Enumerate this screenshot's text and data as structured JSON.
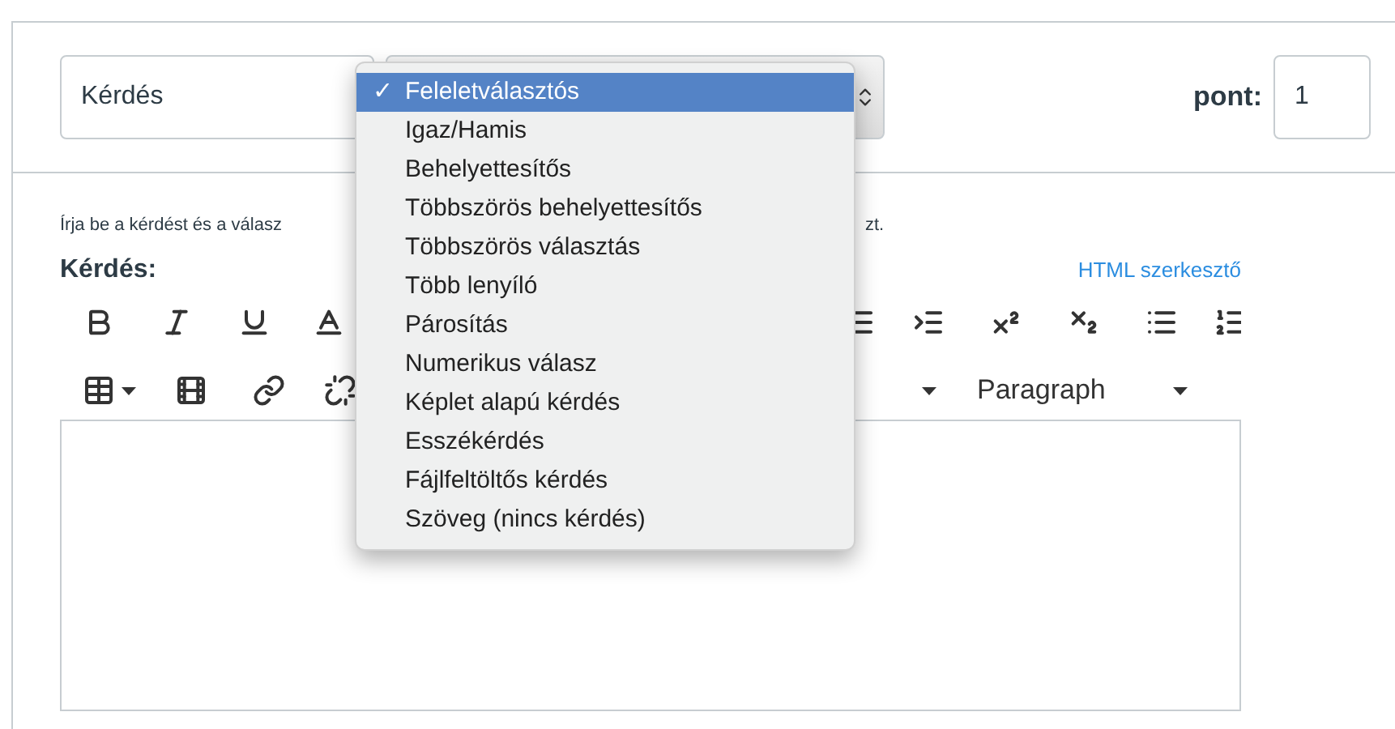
{
  "question_name": {
    "value": "Kérdés"
  },
  "question_type": {
    "check_glyph": "✓",
    "options": [
      {
        "label": "Feleletválasztós",
        "selected": true
      },
      {
        "label": "Igaz/Hamis",
        "selected": false
      },
      {
        "label": "Behelyettesítős",
        "selected": false
      },
      {
        "label": "Többszörös behelyettesítős",
        "selected": false
      },
      {
        "label": "Többszörös választás",
        "selected": false
      },
      {
        "label": "Több lenyíló",
        "selected": false
      },
      {
        "label": "Párosítás",
        "selected": false
      },
      {
        "label": "Numerikus válasz",
        "selected": false
      },
      {
        "label": "Képlet alapú kérdés",
        "selected": false
      },
      {
        "label": "Esszékérdés",
        "selected": false
      },
      {
        "label": "Fájlfeltöltős kérdés",
        "selected": false
      },
      {
        "label": "Szöveg (nincs kérdés)",
        "selected": false
      }
    ]
  },
  "points": {
    "label": "pont:",
    "value": "1"
  },
  "instructions": {
    "start": "Írja be a kérdést és a válasz",
    "end": "zt."
  },
  "editor": {
    "label": "Kérdés:",
    "html_link": "HTML szerkesztő",
    "block_format": "Paragraph"
  }
}
